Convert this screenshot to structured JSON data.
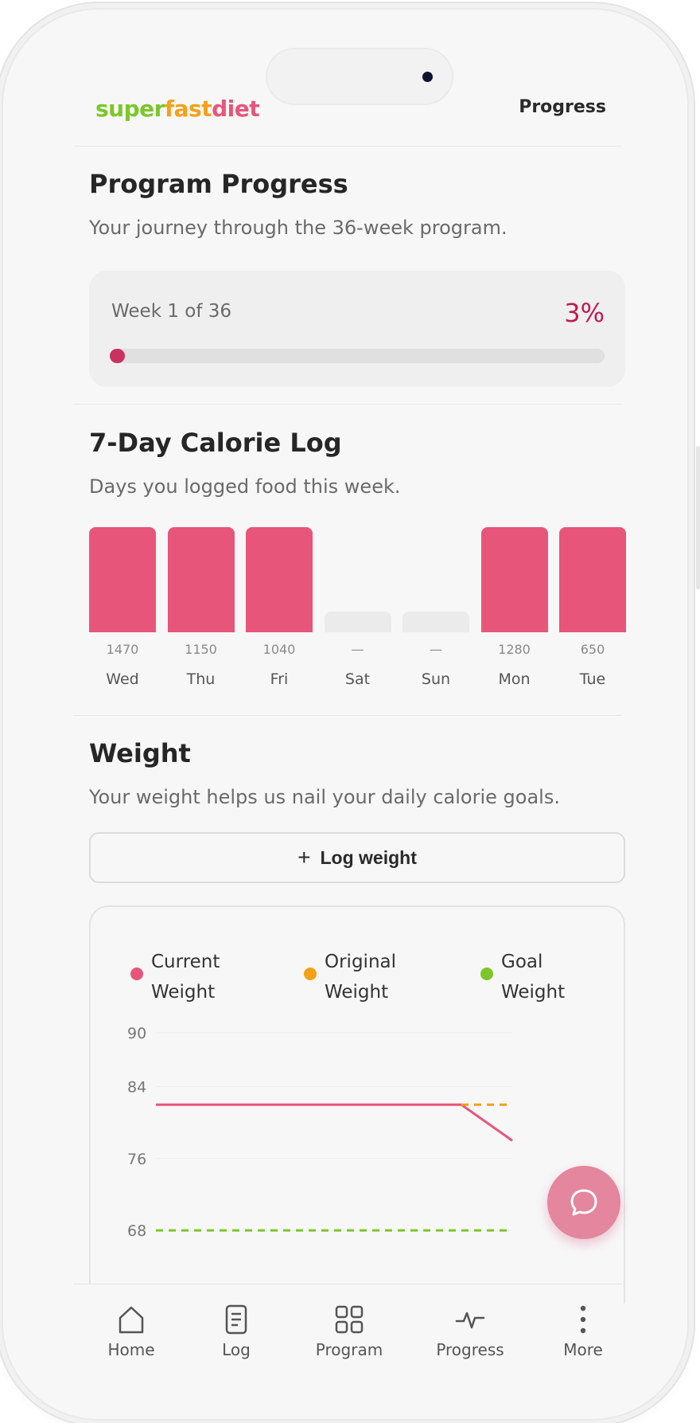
{
  "header": {
    "logo_part1": "super",
    "logo_part2": "fast",
    "logo_part3": "diet",
    "link": "Progress"
  },
  "program": {
    "title": "Program Progress",
    "subtitle": "Your journey through the 36-week program.",
    "week_label": "Week 1 of 36",
    "percent_label": "3%",
    "progress_fraction": 0.03
  },
  "calorie_log": {
    "title": "7-Day Calorie Log",
    "subtitle": "Days you logged food this week.",
    "days": [
      {
        "day": "Wed",
        "value": "1470",
        "logged": true
      },
      {
        "day": "Thu",
        "value": "1150",
        "logged": true
      },
      {
        "day": "Fri",
        "value": "1040",
        "logged": true
      },
      {
        "day": "Sat",
        "value": "—",
        "logged": false
      },
      {
        "day": "Sun",
        "value": "—",
        "logged": false
      },
      {
        "day": "Mon",
        "value": "1280",
        "logged": true
      },
      {
        "day": "Tue",
        "value": "650",
        "logged": true
      }
    ]
  },
  "weight": {
    "title": "Weight",
    "subtitle": "Your weight helps us nail your daily calorie goals.",
    "log_button": "Log weight",
    "legend": [
      {
        "line1": "Current",
        "line2": "Weight",
        "color": "#e8557a"
      },
      {
        "line1": "Original",
        "line2": "Weight",
        "color": "#f4a11a"
      },
      {
        "line1": "Goal",
        "line2": "Weight",
        "color": "#7cc62a"
      }
    ]
  },
  "chart_data": {
    "type": "line",
    "y_ticks": [
      "90",
      "84",
      "76",
      "68"
    ],
    "ylim": [
      65,
      90
    ],
    "grid": true,
    "legend_position": "top",
    "x": [
      0,
      1,
      2,
      3,
      4,
      5,
      6,
      7
    ],
    "series": [
      {
        "name": "Current Weight",
        "color": "#e8557a",
        "style": "solid",
        "values": [
          82,
          82,
          82,
          82,
          82,
          82,
          82,
          78
        ]
      },
      {
        "name": "Original Weight",
        "color": "#f4a11a",
        "style": "dashed",
        "values": [
          null,
          null,
          null,
          null,
          null,
          null,
          82,
          82
        ]
      },
      {
        "name": "Goal Weight",
        "color": "#7cc62a",
        "style": "dashed",
        "values": [
          68,
          68,
          68,
          68,
          68,
          68,
          68,
          68
        ]
      }
    ]
  },
  "tabs": [
    {
      "label": "Home",
      "icon": "home-icon"
    },
    {
      "label": "Log",
      "icon": "log-icon"
    },
    {
      "label": "Program",
      "icon": "grid-icon"
    },
    {
      "label": "Progress",
      "icon": "activity-icon"
    },
    {
      "label": "More",
      "icon": "more-icon"
    }
  ],
  "colors": {
    "accent": "#e8557a",
    "percent_text": "#c21a52",
    "empty_bar": "#ebebeb"
  }
}
